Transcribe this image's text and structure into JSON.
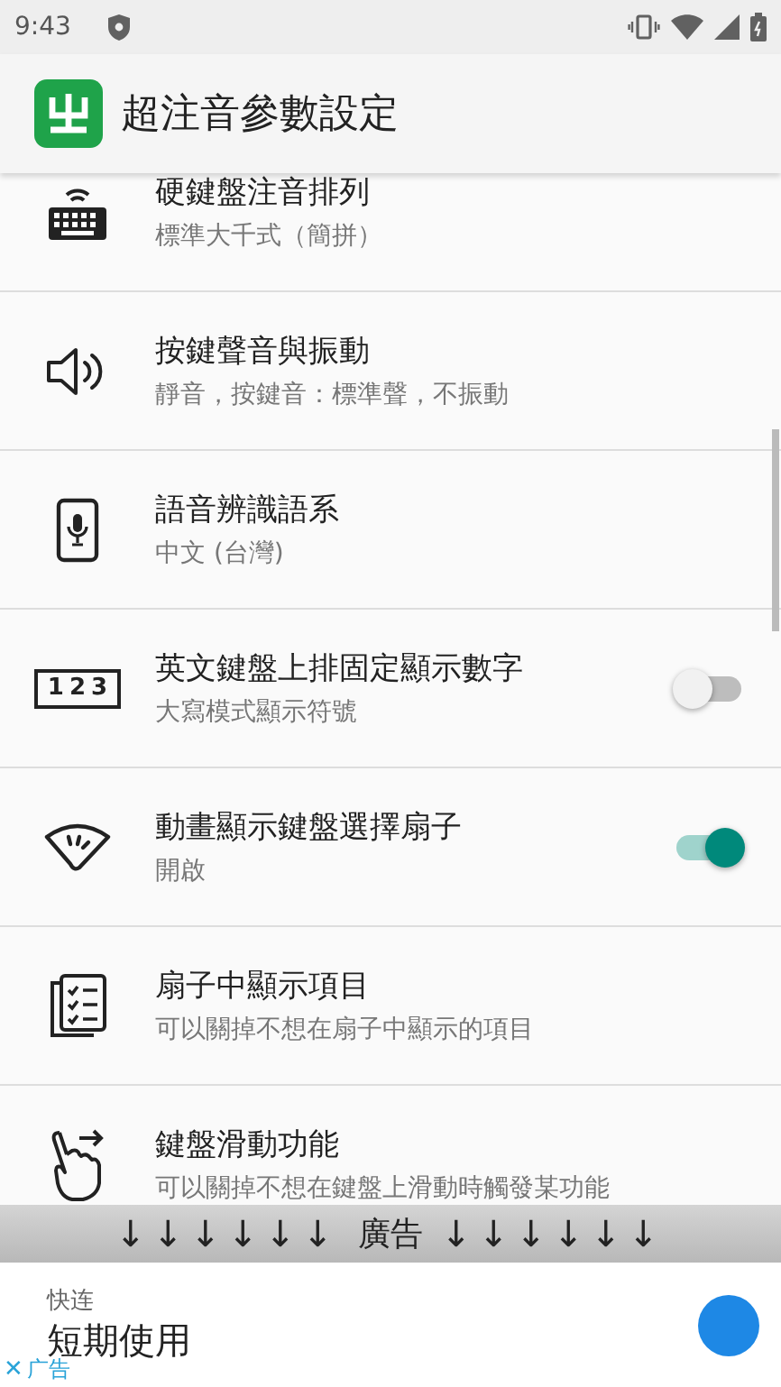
{
  "status_bar": {
    "time": "9:43"
  },
  "app_bar": {
    "title": "超注音參數設定"
  },
  "settings": [
    {
      "kind": "nav",
      "title": "硬鍵盤注音排列",
      "summary": "標準大千式（簡拼）"
    },
    {
      "kind": "nav",
      "title": "按鍵聲音與振動",
      "summary": "靜音，按鍵音：標準聲，不振動"
    },
    {
      "kind": "nav",
      "title": "語音辨識語系",
      "summary": "中文 (台灣)"
    },
    {
      "icon_text": "123",
      "kind": "switch",
      "on": false,
      "title": "英文鍵盤上排固定顯示數字",
      "summary": "大寫模式顯示符號"
    },
    {
      "kind": "switch",
      "on": true,
      "title": "動畫顯示鍵盤選擇扇子",
      "summary": "開啟"
    },
    {
      "kind": "nav",
      "title": "扇子中顯示項目",
      "summary": "可以關掉不想在扇子中顯示的項目"
    },
    {
      "kind": "nav",
      "title": "鍵盤滑動功能",
      "summary": "可以關掉不想在鍵盤上滑動時觸發某功能"
    }
  ],
  "ad_strip": {
    "arrows_left": "↓↓↓↓↓↓",
    "label": "廣告",
    "arrows_right": "↓↓↓↓↓↓"
  },
  "ad": {
    "brand": "快连",
    "headline": "短期使用",
    "close": "✕",
    "tag": "广告"
  }
}
